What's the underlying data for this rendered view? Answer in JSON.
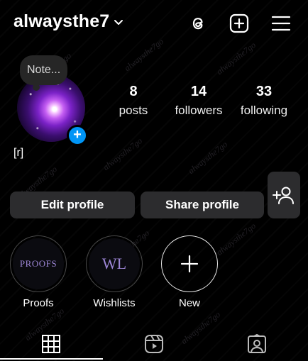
{
  "header": {
    "username": "alwaysthe7"
  },
  "profile": {
    "note_placeholder": "Note...",
    "display_name": "[r]"
  },
  "stats": [
    {
      "value": "8",
      "label": "posts"
    },
    {
      "value": "14",
      "label": "followers"
    },
    {
      "value": "33",
      "label": "following"
    }
  ],
  "actions": {
    "edit_profile": "Edit profile",
    "share_profile": "Share profile"
  },
  "highlights": [
    {
      "cover_text": "PROOFS",
      "label": "Proofs"
    },
    {
      "cover_text": "WL",
      "label": "Wishlists"
    },
    {
      "label": "New"
    }
  ],
  "watermark_text": "alwaysthe7go",
  "colors": {
    "background": "#000000",
    "button_bg": "#2c2c2e",
    "accent_blue": "#0095f6",
    "highlight_text": "#9d86d6"
  },
  "icons": {
    "header": [
      "chevron-down-icon",
      "threads-icon",
      "create-plus-icon",
      "menu-icon"
    ],
    "tabs": [
      "grid-icon",
      "reels-icon",
      "tagged-icon"
    ]
  }
}
